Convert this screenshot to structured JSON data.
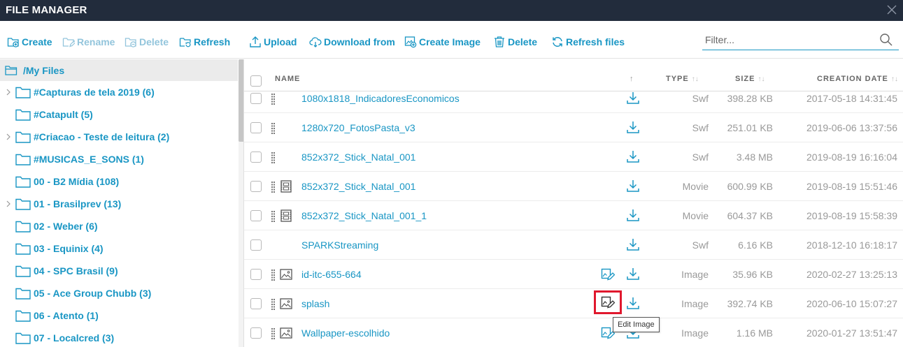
{
  "app": {
    "title": "FILE MANAGER"
  },
  "toolbar": {
    "create": "Create",
    "rename": "Rename",
    "delete_folder": "Delete",
    "refresh": "Refresh",
    "upload": "Upload",
    "download_from": "Download from",
    "create_image": "Create Image",
    "delete_files": "Delete",
    "refresh_files": "Refresh files"
  },
  "filter": {
    "placeholder": "Filter..."
  },
  "sidebar": {
    "root": "/My Files",
    "items": [
      {
        "label": "#Capturas de tela 2019 (6)",
        "expandable": true
      },
      {
        "label": "#Catapult (5)",
        "expandable": false
      },
      {
        "label": "#Criacao - Teste de leitura (2)",
        "expandable": true
      },
      {
        "label": "#MUSICAS_E_SONS (1)",
        "expandable": false
      },
      {
        "label": "00 - B2 Mídia (108)",
        "expandable": false
      },
      {
        "label": "01 - Brasilprev (13)",
        "expandable": true
      },
      {
        "label": "02 - Weber (6)",
        "expandable": false
      },
      {
        "label": "03 - Equinix (4)",
        "expandable": false
      },
      {
        "label": "04 - SPC Brasil (9)",
        "expandable": false
      },
      {
        "label": "05 - Ace Group Chubb (3)",
        "expandable": false
      },
      {
        "label": "06 - Atento (1)",
        "expandable": false
      },
      {
        "label": "07 - Localcred (3)",
        "expandable": false
      }
    ]
  },
  "table": {
    "columns": {
      "name": "NAME",
      "type": "TYPE",
      "size": "SIZE",
      "date": "CREATION DATE"
    },
    "sort_up": "↑",
    "sort_both": "↑↓",
    "rows": [
      {
        "name": "1080x1818_IndicadoresEconomicos",
        "type": "Swf",
        "size": "398.28 KB",
        "date": "2017-05-18 14:31:45",
        "icon": "none",
        "drag": true,
        "edit": false
      },
      {
        "name": "1280x720_FotosPasta_v3",
        "type": "Swf",
        "size": "251.01 KB",
        "date": "2019-06-06 13:37:56",
        "icon": "none",
        "drag": true,
        "edit": false
      },
      {
        "name": "852x372_Stick_Natal_001",
        "type": "Swf",
        "size": "3.48 MB",
        "date": "2019-08-19 16:16:04",
        "icon": "none",
        "drag": true,
        "edit": false
      },
      {
        "name": "852x372_Stick_Natal_001",
        "type": "Movie",
        "size": "600.99 KB",
        "date": "2019-08-19 15:51:46",
        "icon": "film",
        "drag": true,
        "edit": false
      },
      {
        "name": "852x372_Stick_Natal_001_1",
        "type": "Movie",
        "size": "604.37 KB",
        "date": "2019-08-19 15:58:39",
        "icon": "film",
        "drag": true,
        "edit": false
      },
      {
        "name": "SPARKStreaming",
        "type": "Swf",
        "size": "6.16 KB",
        "date": "2018-12-10 16:18:17",
        "icon": "none",
        "drag": false,
        "edit": false
      },
      {
        "name": "id-itc-655-664",
        "type": "Image",
        "size": "35.96 KB",
        "date": "2020-02-27 13:25:13",
        "icon": "image",
        "drag": true,
        "edit": true
      },
      {
        "name": "splash",
        "type": "Image",
        "size": "392.74 KB",
        "date": "2020-06-10 15:07:27",
        "icon": "image",
        "drag": true,
        "edit": true,
        "highlight": true
      },
      {
        "name": "Wallpaper-escolhido",
        "type": "Image",
        "size": "1.16 MB",
        "date": "2020-01-27 13:51:47",
        "icon": "image",
        "drag": true,
        "edit": true
      }
    ]
  },
  "tooltip": {
    "text": "Edit Image"
  },
  "colors": {
    "titlebar": "#222c3c",
    "accent": "#1996c4",
    "highlight": "#e0182d"
  }
}
